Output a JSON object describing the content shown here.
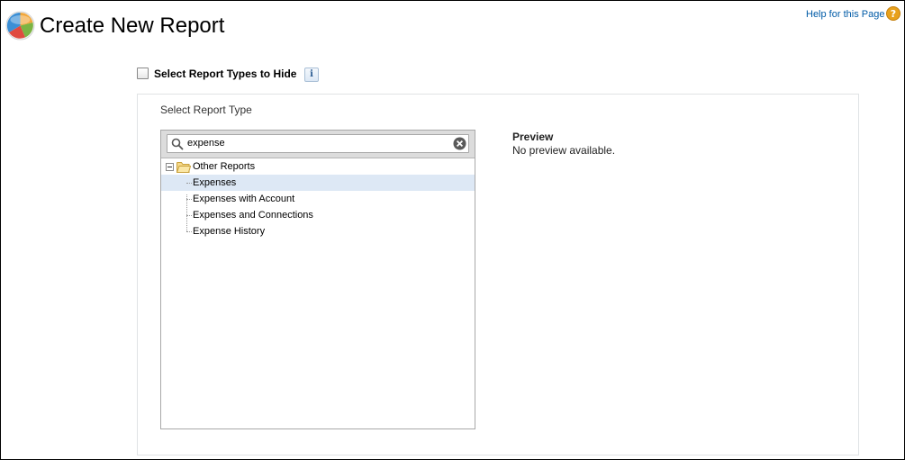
{
  "header": {
    "title": "Create New Report",
    "help_label": "Help for this Page"
  },
  "hide_types": {
    "label": "Select Report Types to Hide",
    "checked": false,
    "info_glyph": "i"
  },
  "panel": {
    "select_label": "Select Report Type",
    "search": {
      "value": "expense",
      "placeholder": ""
    },
    "tree": {
      "folder": "Other Reports",
      "items": [
        {
          "label": "Expenses",
          "selected": true
        },
        {
          "label": "Expenses with Account",
          "selected": false
        },
        {
          "label": "Expenses and Connections",
          "selected": false
        },
        {
          "label": "Expense History",
          "selected": false
        }
      ]
    },
    "preview": {
      "title": "Preview",
      "text": "No preview available."
    }
  },
  "colors": {
    "link": "#015ba7",
    "selected_row": "#dde8f5",
    "toolbar": "#dcdcdc",
    "help_icon": "#e8a11c"
  }
}
